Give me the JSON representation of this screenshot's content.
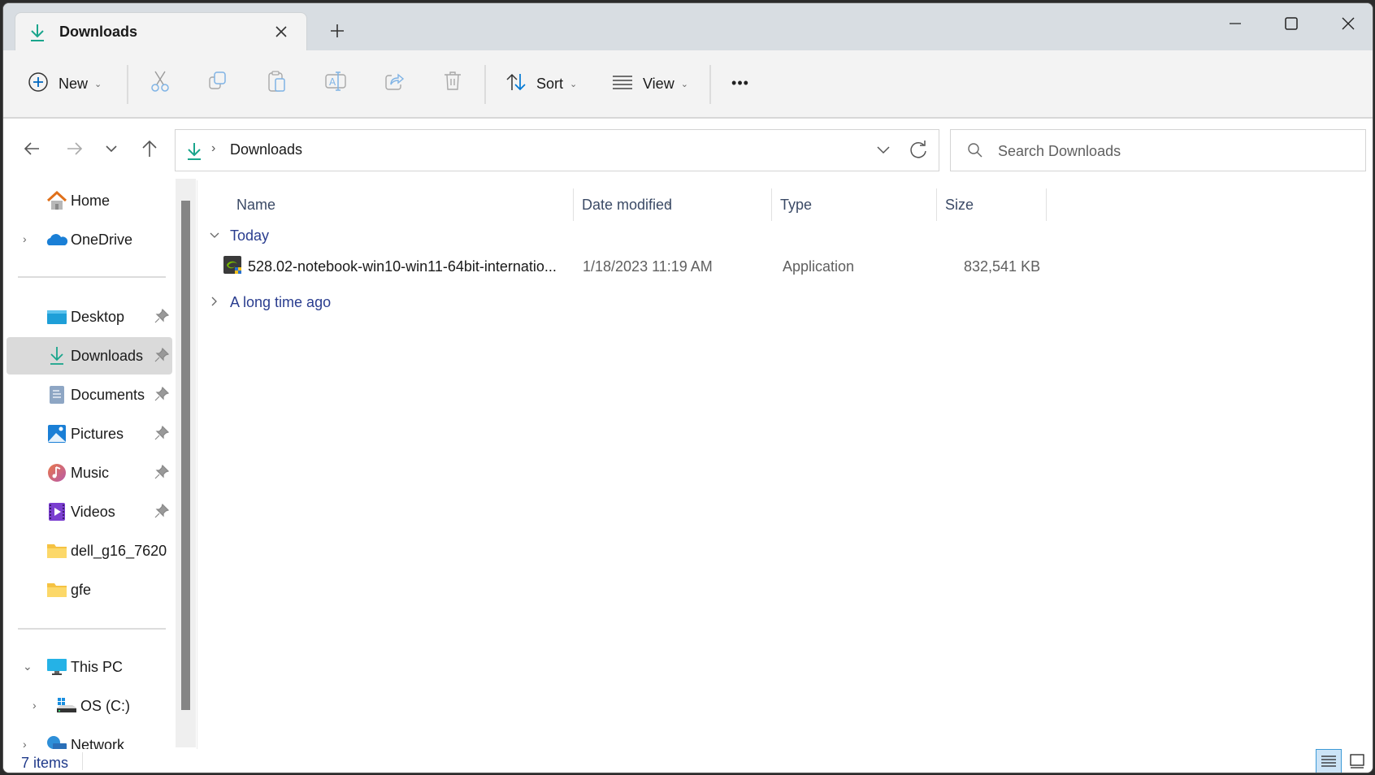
{
  "window": {
    "tab_title": "Downloads",
    "controls": [
      "minimize",
      "maximize",
      "close"
    ]
  },
  "toolbar": {
    "new_label": "New",
    "sort_label": "Sort",
    "view_label": "View",
    "actions": [
      "cut",
      "copy",
      "paste",
      "rename",
      "share",
      "delete"
    ],
    "more_label": "•••"
  },
  "nav": {
    "breadcrumb_sep": "›",
    "breadcrumb": "Downloads",
    "search_placeholder": "Search Downloads"
  },
  "sidebar": {
    "items": [
      {
        "label": "Home",
        "icon": "home-icon"
      },
      {
        "label": "OneDrive",
        "icon": "onedrive-icon",
        "expandable": true
      },
      {
        "label": "Desktop",
        "icon": "desktop-folder-icon",
        "pinned": true
      },
      {
        "label": "Downloads",
        "icon": "downloads-icon",
        "pinned": true,
        "selected": true
      },
      {
        "label": "Documents",
        "icon": "documents-icon",
        "pinned": true
      },
      {
        "label": "Pictures",
        "icon": "pictures-icon",
        "pinned": true
      },
      {
        "label": "Music",
        "icon": "music-icon",
        "pinned": true
      },
      {
        "label": "Videos",
        "icon": "videos-icon",
        "pinned": true
      },
      {
        "label": "dell_g16_7620",
        "icon": "folder-icon"
      },
      {
        "label": "gfe",
        "icon": "folder-icon"
      },
      {
        "label": "This PC",
        "icon": "this-pc-icon",
        "expanded": true
      },
      {
        "label": "OS (C:)",
        "icon": "drive-icon",
        "expandable": true
      },
      {
        "label": "Network",
        "icon": "network-icon",
        "expandable": true
      }
    ]
  },
  "columns": {
    "name": "Name",
    "date": "Date modified",
    "type": "Type",
    "size": "Size"
  },
  "groups": [
    {
      "label": "Today",
      "expanded": true
    },
    {
      "label": "A long time ago",
      "expanded": false
    }
  ],
  "files": [
    {
      "name": "528.02-notebook-win10-win11-64bit-internatio...",
      "date": "1/18/2023 11:19 AM",
      "type": "Application",
      "size": "832,541 KB"
    }
  ],
  "status": {
    "item_count": "7 items"
  },
  "colors": {
    "accent": "#0067c0",
    "download_green": "#1aa58c",
    "group_text": "#2a3d8f"
  }
}
